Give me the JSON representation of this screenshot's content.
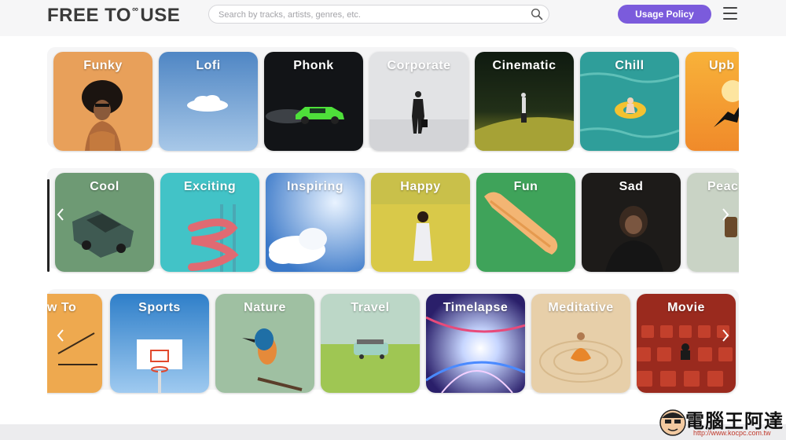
{
  "header": {
    "logo_left": "FREE TO",
    "logo_inf": "∞",
    "logo_right": "USE",
    "search_placeholder": "Search by tracks, artists, genres, etc.",
    "usage_label": "Usage Policy"
  },
  "row1": [
    "Funky",
    "Lofi",
    "Phonk",
    "Corporate",
    "Cinematic",
    "Chill",
    "Upb"
  ],
  "row2": [
    "Cool",
    "Exciting",
    "Inspiring",
    "Happy",
    "Fun",
    "Sad",
    "Peac"
  ],
  "row3": [
    "w To",
    "Sports",
    "Nature",
    "Travel",
    "Timelapse",
    "Meditative",
    "Movie"
  ],
  "watermark": {
    "text": "電腦王阿達",
    "url": "http://www.kocpc.com.tw"
  },
  "colors": {
    "accent": "#7b5bdc"
  }
}
